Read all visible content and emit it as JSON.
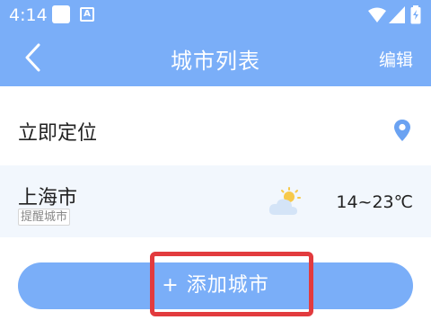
{
  "status_bar": {
    "time": "4:14",
    "notification_badge": "A"
  },
  "nav": {
    "title": "城市列表",
    "edit_label": "编辑",
    "back_icon": "chevron-left-icon"
  },
  "locate": {
    "label": "立即定位",
    "icon": "location-pin-icon"
  },
  "city": {
    "name": "上海市",
    "tag": "提醒城市",
    "temperature": "14~23℃",
    "weather_icon": "partly-cloudy-icon"
  },
  "add_button": {
    "label": "+ 添加城市"
  },
  "colors": {
    "header": "#7aaef8",
    "row_bg": "#f2f7fd",
    "highlight": "#e23b3e"
  }
}
